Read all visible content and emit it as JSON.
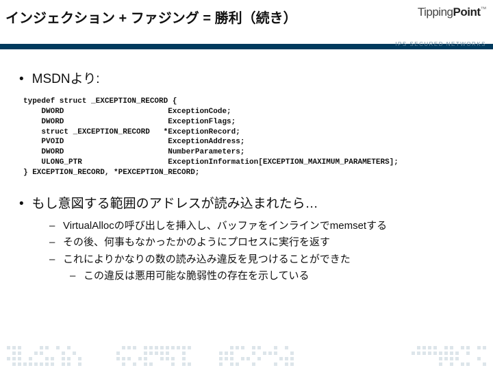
{
  "header": {
    "title": "インジェクション + ファジング = 勝利（続き）",
    "logo_light": "Tipping",
    "logo_bold": "Point",
    "tm": "™",
    "tagline": "IPS SECURED NETWORKS"
  },
  "intro": {
    "label": "MSDNより:"
  },
  "code": "typedef struct _EXCEPTION_RECORD {\n    DWORD                       ExceptionCode;\n    DWORD                       ExceptionFlags;\n    struct _EXCEPTION_RECORD   *ExceptionRecord;\n    PVOID                       ExceptionAddress;\n    DWORD                       NumberParameters;\n    ULONG_PTR                   ExceptionInformation[EXCEPTION_MAXIMUM_PARAMETERS];\n} EXCEPTION_RECORD, *PEXCEPTION_RECORD;",
  "second": {
    "label": "もし意図する範囲のアドレスが読み込まれたら…"
  },
  "subs": {
    "s1": "VirtualAllocの呼び出しを挿入し、バッファをインラインでmemsetする",
    "s2": "その後、何事もなかったかのようにプロセスに実行を返す",
    "s3": "これによりかなりの数の読み込み違反を見つけることができた",
    "s4": "この違反は悪用可能な脆弱性の存在を示している"
  }
}
